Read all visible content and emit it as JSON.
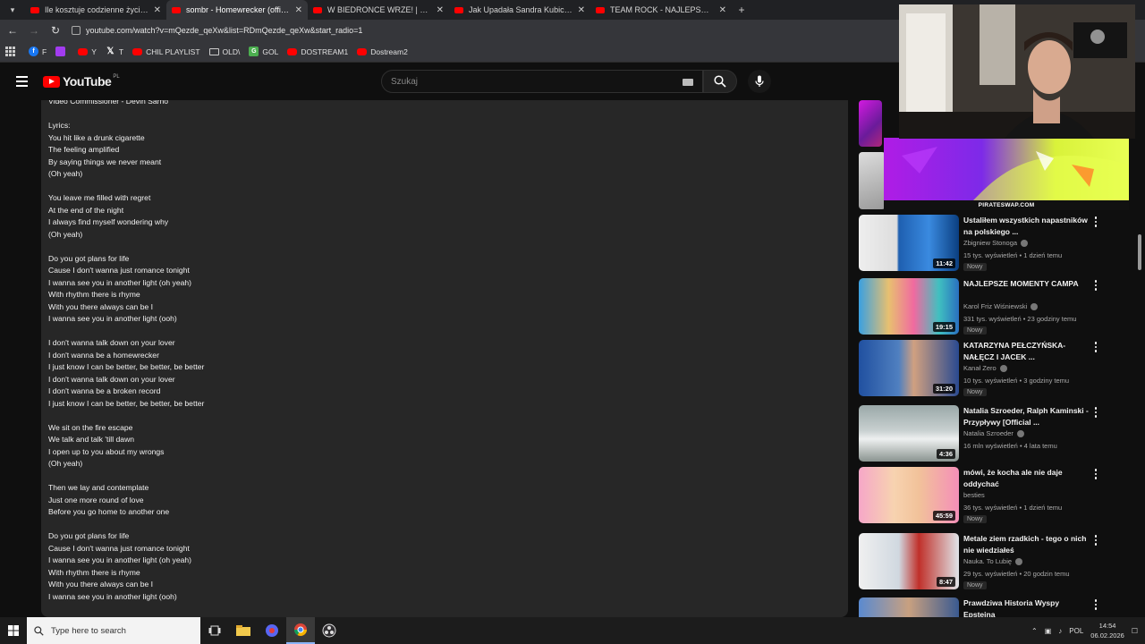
{
  "browser": {
    "tabs": [
      {
        "label": "Ile kosztuje codzienne życie w Japonii"
      },
      {
        "label": "sombr - Homewrecker (official video)"
      },
      {
        "label": "W BIEDRONCE WRZE! | NIEMIECKI"
      },
      {
        "label": "Jak Upadała Sandra Kubicka i Jej"
      },
      {
        "label": "TEAM ROCK - NAJLEPSZE MOMENTY"
      }
    ],
    "url": "youtube.com/watch?v=mQezde_qeXw&list=RDmQezde_qeXw&start_radio=1",
    "bookmarks": [
      {
        "label": "F",
        "icon_color": "#1877f2",
        "icon": "facebook-icon"
      },
      {
        "label": "",
        "icon_color": "#a23cf0",
        "icon": "twitch-icon"
      },
      {
        "label": "Y",
        "icon_color": "#ff0000",
        "icon": "youtube-icon"
      },
      {
        "label": "T",
        "icon_color": "#222222",
        "icon": "x-icon"
      },
      {
        "label": "CHIL PLAYLIST",
        "icon_color": "#ff0000",
        "icon": "youtube-icon"
      },
      {
        "label": "OLD\\",
        "icon_color": "",
        "icon": "folder-icon"
      },
      {
        "label": "GOL",
        "icon_color": "#4caf50",
        "icon": "gol-icon"
      },
      {
        "label": "DOSTREAM1",
        "icon_color": "#ff0000",
        "icon": "youtube-icon"
      },
      {
        "label": "Dostream2",
        "icon_color": "#ff0000",
        "icon": "youtube-icon"
      }
    ]
  },
  "youtube": {
    "logo_text": "YouTube",
    "country_code": "PL",
    "search_placeholder": "Szukaj"
  },
  "description": {
    "lines": [
      "Video Commissioner - Devin Sarno",
      "",
      "Lyrics:",
      "You hit like a drunk cigarette",
      "The feeling amplified",
      "By saying things we never meant",
      "(Oh yeah)",
      "",
      "You leave me filled with regret",
      "At the end of the night",
      "I always find myself wondering why",
      "(Oh yeah)",
      "",
      "Do you got plans for life",
      "Cause I don't wanna just romance tonight",
      "I wanna see you in another light (oh yeah)",
      "With rhythm there is rhyme",
      "With you there always can be I",
      "I wanna see you in another light (ooh)",
      "",
      "I don't wanna talk down on your lover",
      "I don't wanna be a homewrecker",
      "I just know I can be better, be better, be better",
      "I don't wanna talk down on your lover",
      "I don't wanna be a broken record",
      "I just know I can be better, be better, be better",
      "",
      "We sit on the fire escape",
      "We talk and talk 'till dawn",
      "I open up to you about my wrongs",
      "(Oh yeah)",
      "",
      "Then we lay and contemplate",
      "Just one more round of love",
      "Before you go home to another one",
      "",
      "Do you got plans for life",
      "Cause I don't wanna just romance tonight",
      "I wanna see you in another light (oh yeah)",
      "With rhythm there is rhyme",
      "With you there always can be I",
      "I wanna see you in another light (ooh)",
      "",
      "I don't wanna talk down on your lover"
    ]
  },
  "sidebar": {
    "promo_label": "PIRATESWAP.COM",
    "videos": [
      {
        "title": "Ustaliłem wszystkich napastników na polskiego ...",
        "channel": "Zbigniew Stonoga",
        "verified": true,
        "meta": "15 tys. wyświetleń • 1 dzień temu",
        "badge": "Nowy",
        "duration": "11:42",
        "thumb": "linear-gradient(90deg,#eee 0%,#ddd 38%,#1e5fb0 40%,#3a8ae0 70%,#0b3f80 100%)"
      },
      {
        "title": "NAJLEPSZE MOMENTY CAMPA",
        "channel": "Karol Friz Wiśniewski",
        "verified": true,
        "meta": "331 tys. wyświetleń • 23 godziny temu",
        "badge": "Nowy",
        "duration": "19:15",
        "thumb": "linear-gradient(90deg,#3aa0e0,#e8c070 30%,#f06aa0 55%,#40c0c0 80%,#2a70c0)"
      },
      {
        "title": "KATARZYNA PEŁCZYŃSKA-NAŁĘCZ I JACEK ...",
        "channel": "Kanał Zero",
        "verified": true,
        "meta": "10 tys. wyświetleń • 3 godziny temu",
        "badge": "Nowy",
        "duration": "31:20",
        "thumb": "linear-gradient(90deg,#2050a0,#5080c0 40%,#d0a080 55%,#2a4a90 100%)"
      },
      {
        "title": "Natalia Szroeder, Ralph Kaminski - Przypływy [Official ...",
        "channel": "Natalia Szroeder",
        "verified": true,
        "meta": "16 mln wyświetleń • 4 lata temu",
        "badge": "",
        "duration": "4:36",
        "thumb": "linear-gradient(180deg,#9aa8a8,#c8d0d0 45%,#eef0f0 60%,#8a9490)"
      },
      {
        "title": "mówi, że kocha ale nie daje oddychać",
        "channel": "besties",
        "verified": false,
        "meta": "36 tys. wyświetleń • 1 dzień temu",
        "badge": "Nowy",
        "duration": "45:59",
        "thumb": "linear-gradient(90deg,#f6a7c8,#f7d3b0 35%,#f2c29a 60%,#f48fb8)"
      },
      {
        "title": "Metale ziem rzadkich - tego o nich nie wiedziałeś",
        "channel": "Nauka. To Lubię",
        "verified": true,
        "meta": "29 tys. wyświetleń • 20 godzin temu",
        "badge": "Nowy",
        "duration": "8:47",
        "thumb": "linear-gradient(90deg,#f0f0f0,#d0d8e0 40%,#c0302a 60%,#e0e4e8)"
      },
      {
        "title": "Prawdziwa Historia Wyspy Epsteina",
        "channel": "",
        "verified": false,
        "meta": "",
        "badge": "",
        "duration": "",
        "thumb": "linear-gradient(90deg,#5a8ad0,#c8a080 50%,#3a5a90)"
      }
    ]
  },
  "taskbar": {
    "search_placeholder": "Type here to search",
    "language": "POL",
    "time": "14:54",
    "date": "06.02.2026"
  }
}
